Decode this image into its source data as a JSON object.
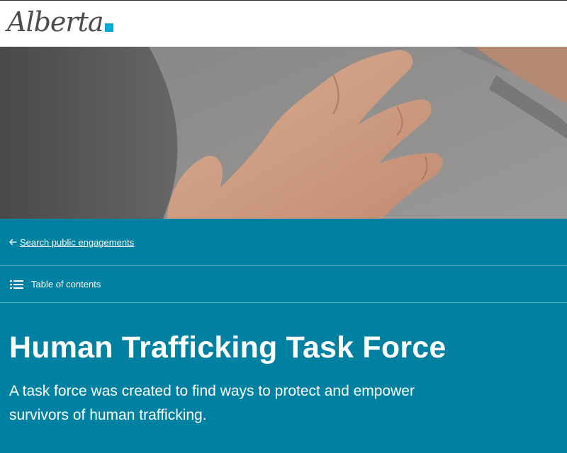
{
  "header": {
    "logo_text": "Alberta",
    "logo_icon": "alberta-logo",
    "accent_color": "#00aad2"
  },
  "hero": {
    "image_subject": "hands-clasping-grey-sweater-photo"
  },
  "nav": {
    "back_label": "Search public engagements",
    "back_icon": "arrow-left-icon",
    "toc_label": "Table of contents",
    "toc_icon": "list-icon"
  },
  "content": {
    "title": "Human Trafficking Task Force",
    "subtitle": "A task force was created to find ways to protect and empower survivors of human trafficking."
  },
  "colors": {
    "teal_background": "#0081a2",
    "text": "#ffffff"
  }
}
